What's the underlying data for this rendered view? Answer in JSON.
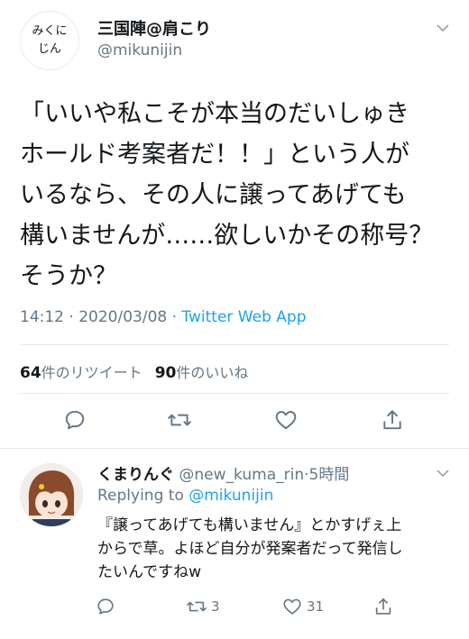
{
  "tweet": {
    "avatar_line1": "みくに",
    "avatar_line2": "じん",
    "display_name": "三国陣@肩こり",
    "handle": "@mikunijin",
    "text": "「いいや私こそが本当のだいしゅき\nホールド考案者だ！！」という人が\nいるなら、その人に譲ってあげても\n構いませんが……欲しいかその称号？\nそうか？",
    "time": "14:12",
    "date": "2020/03/08",
    "separator": "·",
    "app": "Twitter Web App",
    "retweet_count": "64",
    "retweet_label": "件のリツイート",
    "like_count": "90",
    "like_label": "件のいいね"
  },
  "reply": {
    "display_name": "くまりんぐ",
    "handle": "@new_kuma_rin",
    "separator": "·",
    "time": "5時間",
    "replying_label": "Replying to",
    "replying_to": "@mikunijin",
    "text": "『譲ってあげても構いません』とかすげぇ上\nからで草。よほど自分が発案者だって発信し\nたいんですねw",
    "retweet_count": "3",
    "like_count": "31"
  },
  "icons": {
    "reply": "reply-icon",
    "retweet": "retweet-icon",
    "like": "heart-icon",
    "share": "share-icon",
    "menu": "chevron-down-icon"
  },
  "colors": {
    "text": "#14171a",
    "secondary": "#657786",
    "link": "#1da1f2",
    "divider": "#e1e8ed"
  }
}
